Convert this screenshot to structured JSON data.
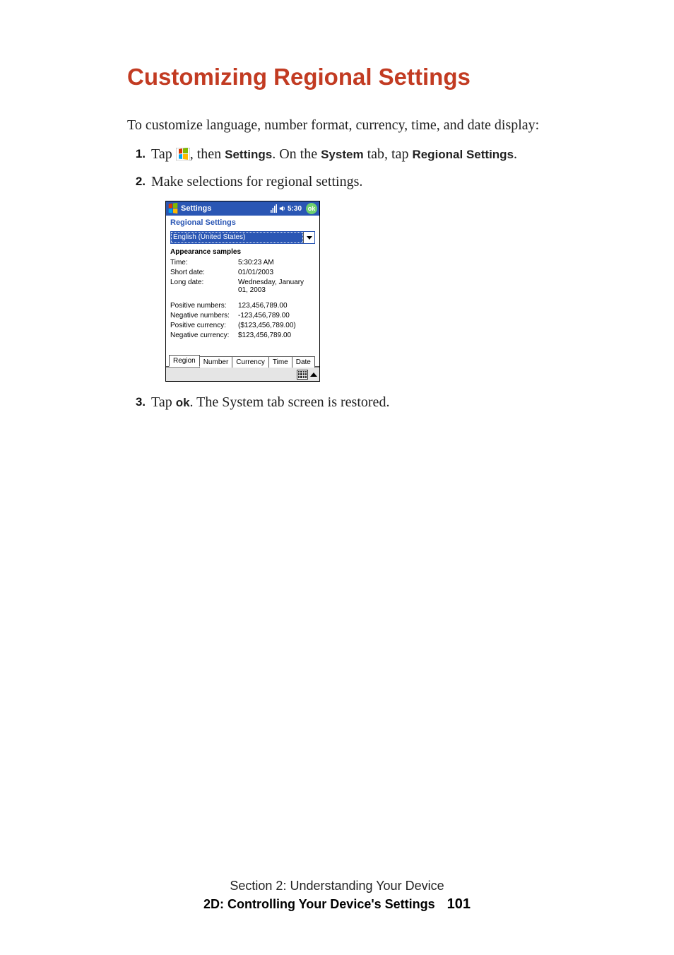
{
  "heading": "Customizing Regional Settings",
  "intro": "To customize language, number format, currency, time, and date display:",
  "step1": {
    "num": "1.",
    "tap_pre": "Tap ",
    "tap_post": ", then ",
    "settings_bold": "Settings",
    "on_the": ". On the ",
    "system_bold": "System",
    "tab_tap": " tab, tap ",
    "regional_bold": "Regional Settings",
    "end": "."
  },
  "step2": {
    "num": "2.",
    "text": "Make selections for regional settings."
  },
  "step3": {
    "num": "3.",
    "pre": "Tap ",
    "ok_bold": "ok",
    "post": ". The System tab screen is restored."
  },
  "ppc": {
    "title": "Settings",
    "time": "5:30",
    "ok": "ok",
    "subtitle": "Regional Settings",
    "combo": "English (United States)",
    "section_label": "Appearance samples",
    "samples": [
      {
        "k": "Time:",
        "v": "5:30:23 AM"
      },
      {
        "k": "Short date:",
        "v": "01/01/2003"
      },
      {
        "k": "Long date:",
        "v": "Wednesday, January 01, 2003"
      }
    ],
    "samples2": [
      {
        "k": "Positive numbers:",
        "v": "123,456,789.00"
      },
      {
        "k": "Negative numbers:",
        "v": "-123,456,789.00"
      },
      {
        "k": "Positive currency:",
        "v": "($123,456,789.00)"
      },
      {
        "k": "Negative currency:",
        "v": "$123,456,789.00"
      }
    ],
    "tabs": [
      "Region",
      "Number",
      "Currency",
      "Time",
      "Date"
    ]
  },
  "footer": {
    "line1": "Section 2: Understanding Your Device",
    "line2_bold": "2D: Controlling Your Device's Settings",
    "page": "101"
  }
}
